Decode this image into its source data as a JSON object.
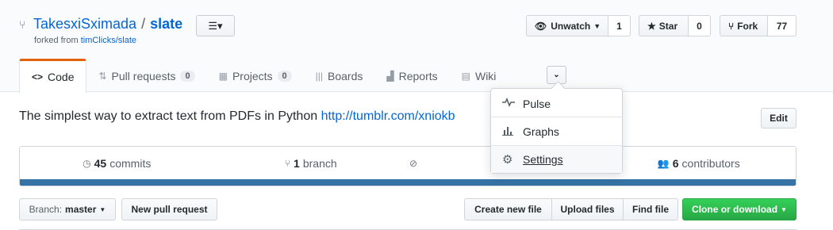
{
  "repo": {
    "owner": "TakesxiSximada",
    "separator": "/",
    "name": "slate",
    "forked_from_prefix": "forked from",
    "forked_from_link": "timClicks/slate",
    "list_button_icon": "☰▾"
  },
  "social": {
    "unwatch_label": "Unwatch",
    "watch_count": "1",
    "star_label": "Star",
    "star_count": "0",
    "fork_label": "Fork",
    "fork_count": "77"
  },
  "tabs": [
    {
      "label": "Code",
      "icon": "<>",
      "count": ""
    },
    {
      "label": "Pull requests",
      "icon": "⇅",
      "count": "0"
    },
    {
      "label": "Projects",
      "icon": "▦",
      "count": "0"
    },
    {
      "label": "Boards",
      "icon": "|||",
      "count": ""
    },
    {
      "label": "Reports",
      "icon": "▟",
      "count": ""
    },
    {
      "label": "Wiki",
      "icon": "▤",
      "count": ""
    }
  ],
  "more_button_icon": "⌄",
  "description": {
    "text": "The simplest way to extract text from PDFs in Python ",
    "link": "http://tumblr.com/xniokb",
    "edit_label": "Edit"
  },
  "summary": {
    "commits_count": "45",
    "commits_label": "commits",
    "branch_count": "1",
    "branch_label": "branch",
    "releases_icon": "⊘",
    "contributors_count": "6",
    "contributors_label": "contributors",
    "language_color": "#3572a5"
  },
  "toolbar": {
    "branch_prefix": "Branch:",
    "branch_name": "master",
    "new_pr_label": "New pull request",
    "create_file_label": "Create new file",
    "upload_label": "Upload files",
    "find_label": "Find file",
    "clone_label": "Clone or download"
  },
  "dropdown": {
    "items": [
      {
        "label": "Pulse",
        "icon": "pulse-icon"
      },
      {
        "label": "Graphs",
        "icon": "graph-icon"
      },
      {
        "label": "Settings",
        "icon": "gear-icon"
      }
    ]
  }
}
